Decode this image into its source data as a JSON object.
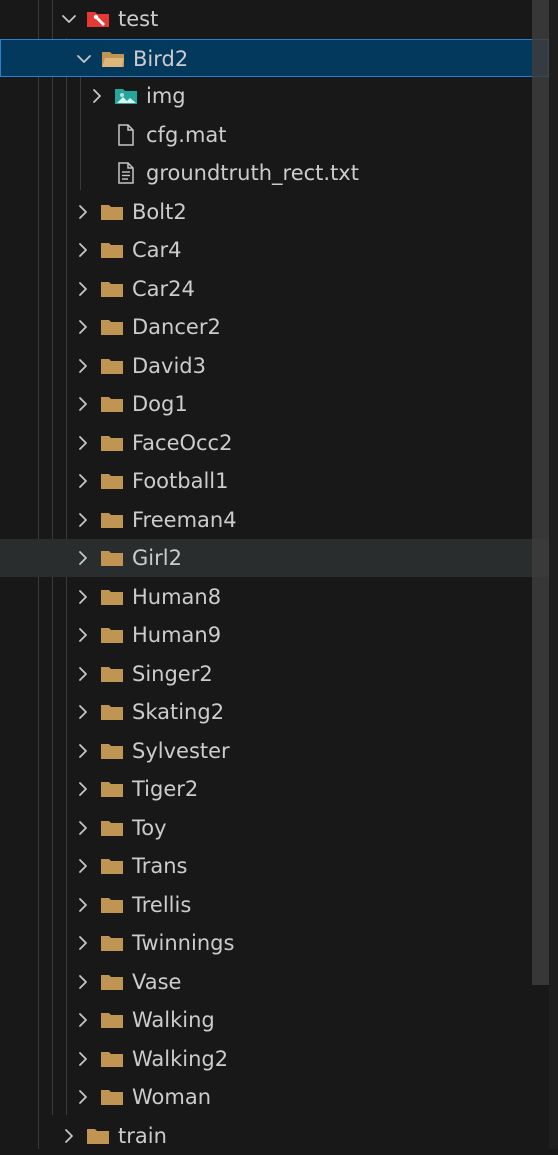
{
  "explorer": {
    "items": [
      {
        "label": "test",
        "level": 0,
        "expanded": true,
        "icon": "test-folder-icon",
        "chevron": "down"
      },
      {
        "label": "Bird2",
        "level": 1,
        "expanded": true,
        "icon": "folder-open-icon",
        "chevron": "down",
        "state": "selected"
      },
      {
        "label": "img",
        "level": 2,
        "expanded": false,
        "icon": "image-folder-icon",
        "chevron": "right"
      },
      {
        "label": "cfg.mat",
        "level": 2,
        "icon": "file-icon",
        "chevron": "none"
      },
      {
        "label": "groundtruth_rect.txt",
        "level": 2,
        "icon": "text-file-icon",
        "chevron": "none"
      },
      {
        "label": "Bolt2",
        "level": 1,
        "icon": "folder-icon",
        "chevron": "right"
      },
      {
        "label": "Car4",
        "level": 1,
        "icon": "folder-icon",
        "chevron": "right"
      },
      {
        "label": "Car24",
        "level": 1,
        "icon": "folder-icon",
        "chevron": "right"
      },
      {
        "label": "Dancer2",
        "level": 1,
        "icon": "folder-icon",
        "chevron": "right"
      },
      {
        "label": "David3",
        "level": 1,
        "icon": "folder-icon",
        "chevron": "right"
      },
      {
        "label": "Dog1",
        "level": 1,
        "icon": "folder-icon",
        "chevron": "right"
      },
      {
        "label": "FaceOcc2",
        "level": 1,
        "icon": "folder-icon",
        "chevron": "right"
      },
      {
        "label": "Football1",
        "level": 1,
        "icon": "folder-icon",
        "chevron": "right"
      },
      {
        "label": "Freeman4",
        "level": 1,
        "icon": "folder-icon",
        "chevron": "right"
      },
      {
        "label": "Girl2",
        "level": 1,
        "icon": "folder-icon",
        "chevron": "right",
        "state": "hovered"
      },
      {
        "label": "Human8",
        "level": 1,
        "icon": "folder-icon",
        "chevron": "right"
      },
      {
        "label": "Human9",
        "level": 1,
        "icon": "folder-icon",
        "chevron": "right"
      },
      {
        "label": "Singer2",
        "level": 1,
        "icon": "folder-icon",
        "chevron": "right"
      },
      {
        "label": "Skating2",
        "level": 1,
        "icon": "folder-icon",
        "chevron": "right"
      },
      {
        "label": "Sylvester",
        "level": 1,
        "icon": "folder-icon",
        "chevron": "right"
      },
      {
        "label": "Tiger2",
        "level": 1,
        "icon": "folder-icon",
        "chevron": "right"
      },
      {
        "label": "Toy",
        "level": 1,
        "icon": "folder-icon",
        "chevron": "right"
      },
      {
        "label": "Trans",
        "level": 1,
        "icon": "folder-icon",
        "chevron": "right"
      },
      {
        "label": "Trellis",
        "level": 1,
        "icon": "folder-icon",
        "chevron": "right"
      },
      {
        "label": "Twinnings",
        "level": 1,
        "icon": "folder-icon",
        "chevron": "right"
      },
      {
        "label": "Vase",
        "level": 1,
        "icon": "folder-icon",
        "chevron": "right"
      },
      {
        "label": "Walking",
        "level": 1,
        "icon": "folder-icon",
        "chevron": "right"
      },
      {
        "label": "Walking2",
        "level": 1,
        "icon": "folder-icon",
        "chevron": "right"
      },
      {
        "label": "Woman",
        "level": 1,
        "icon": "folder-icon",
        "chevron": "right"
      },
      {
        "label": "train",
        "level": 0,
        "icon": "folder-icon",
        "chevron": "right"
      }
    ]
  },
  "colors": {
    "background": "#181818",
    "text": "#cccccc",
    "folder": "#c09553",
    "selected_bg": "#04395e",
    "selected_border": "#2f7fd1",
    "hover_bg": "#2a2d2e",
    "image_icon": "#26a69a",
    "test_icon": "#e53935"
  }
}
